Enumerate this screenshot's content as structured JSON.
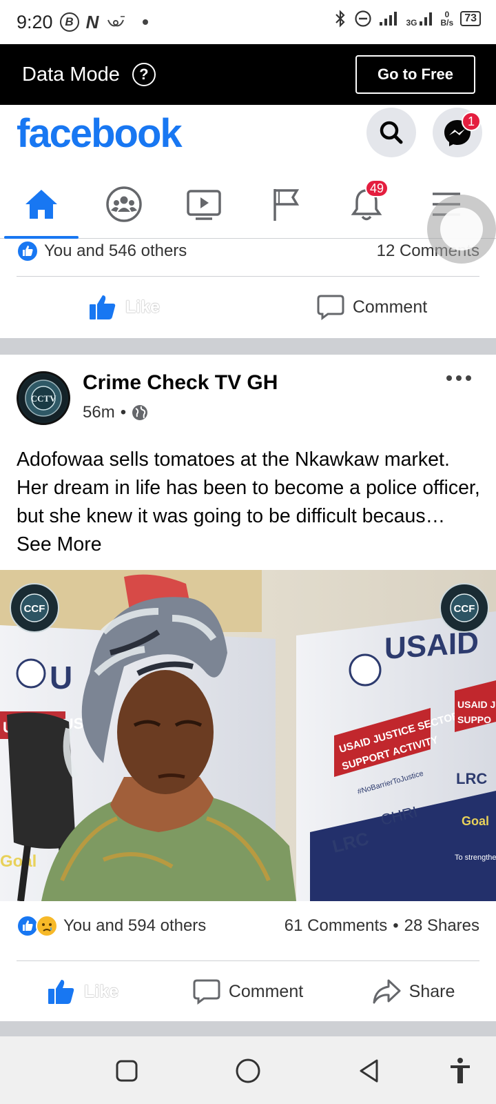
{
  "status_bar": {
    "time": "9:20",
    "icon_b": "B",
    "icon_n": "N",
    "network_label": "3G",
    "speed_value": "0",
    "speed_unit": "B/s",
    "battery": "73"
  },
  "data_mode": {
    "label": "Data Mode",
    "help": "?",
    "button_label": "Go to Free"
  },
  "header": {
    "logo": "facebook",
    "messenger_badge": "1",
    "brand_color": "#1877f2",
    "badge_color": "#e41e3f"
  },
  "nav": {
    "tabs": [
      {
        "name": "home",
        "icon": "home-icon",
        "active": true
      },
      {
        "name": "groups",
        "icon": "groups-icon"
      },
      {
        "name": "watch",
        "icon": "video-icon"
      },
      {
        "name": "pages",
        "icon": "flag-icon"
      },
      {
        "name": "notifications",
        "icon": "bell-icon",
        "badge": "49"
      },
      {
        "name": "menu",
        "icon": "menu-icon"
      }
    ],
    "notification_badge": "49"
  },
  "previous_post": {
    "reactions_text": "You and 546 others",
    "comments_text": "12 Comments",
    "like_label": "Like",
    "comment_label": "Comment"
  },
  "post": {
    "author": "Crime Check TV GH",
    "time": "56m",
    "separator": "•",
    "avatar_text": "CCTV",
    "text": "Adofowaa sells tomatoes at the Nkawkaw market. Her dream in life has been to become a police officer, but she knew it was going to be difficult becaus…",
    "see_more": " See More",
    "image": {
      "logo_text": "CCF",
      "banner_brand": "USAID",
      "banner_line1": "USAID JUSTICE SECTOR",
      "banner_line2": "SUPPORT ACTIVITY",
      "banner_tag": "#NoBarrierToJustice",
      "banner_partner1": "LRC",
      "banner_partner2": "CHRI",
      "left_banner": "USAID JUS",
      "left_brand": "U",
      "right_banner1": "USAID JU",
      "right_banner2": "SUPPO",
      "right_bottom": "Goal",
      "left_bottom": "Goal",
      "right_partner": "LRC",
      "small_text": "To strengthen"
    },
    "reactions_text": "You and 594 others",
    "comments_text": "61 Comments",
    "shares_text": "28 Shares",
    "stats_separator": "•",
    "like_label": "Like",
    "comment_label": "Comment",
    "share_label": "Share"
  },
  "system_nav": {
    "buttons": [
      "recents-icon",
      "home-circle-icon",
      "back-icon",
      "accessibility-icon"
    ]
  }
}
